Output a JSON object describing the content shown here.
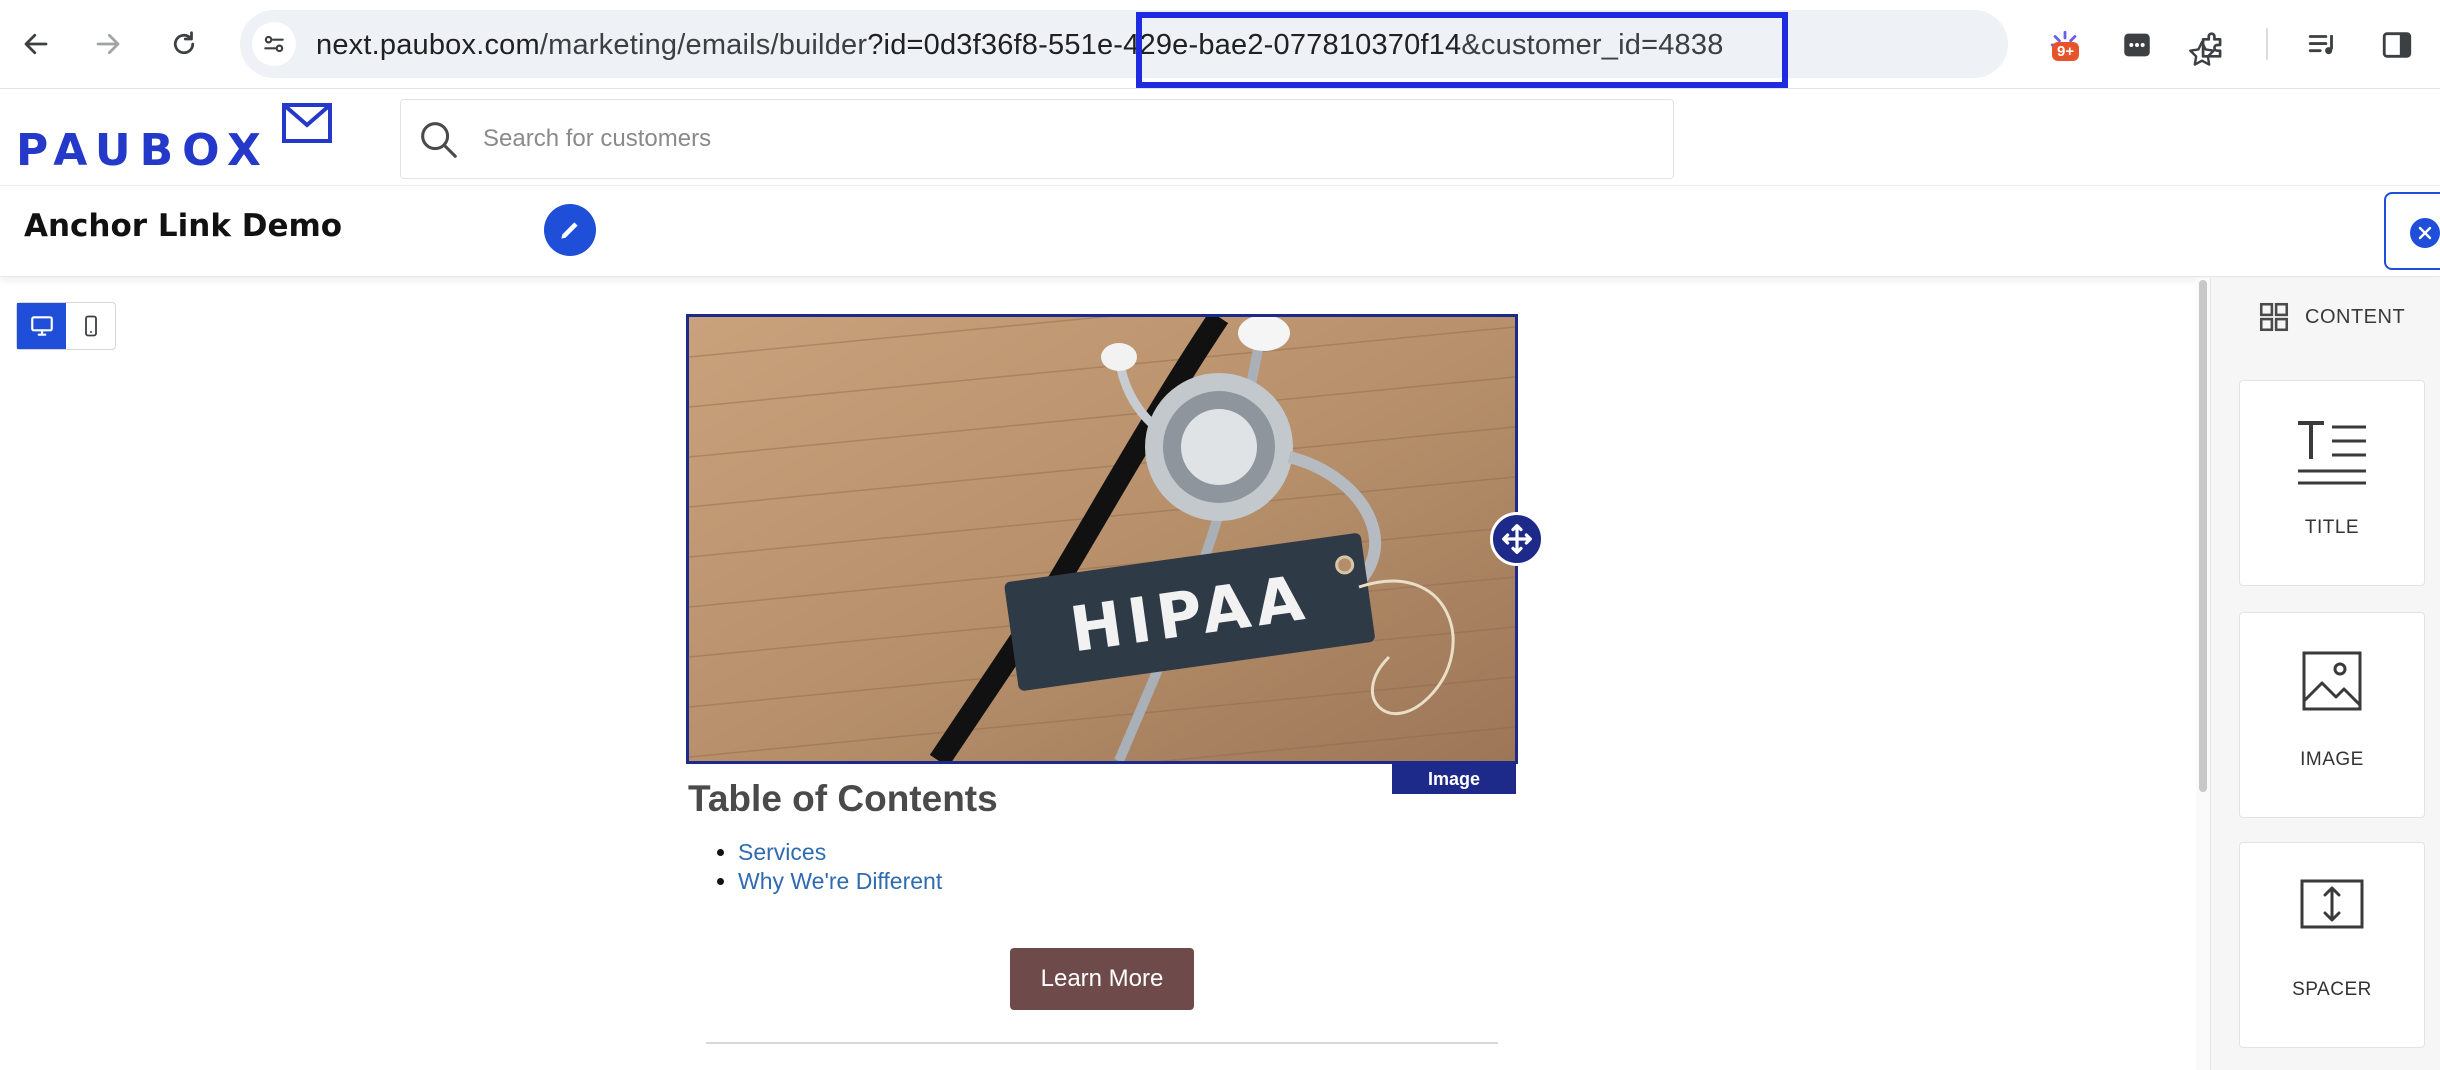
{
  "browser": {
    "url_prefix": "next.paubox.com",
    "url_path": "/marketing/emails/builder",
    "url_highlighted": "?id=0d3f36f8-551e-429e-bae2-077810370f14",
    "url_suffix": "&customer_id=4838",
    "extension_badge": "9+"
  },
  "header": {
    "logo_text": "PAUBOX",
    "search_placeholder": "Search for customers"
  },
  "title_bar": {
    "title": "Anchor Link Demo"
  },
  "canvas": {
    "image_caption_text": "HIPAA",
    "image_tag": "Image",
    "toc_heading": "Table of Contents",
    "toc_items": [
      "Services",
      "Why We're Different"
    ],
    "cta_label": "Learn More"
  },
  "panel": {
    "heading": "CONTENT",
    "tiles": [
      {
        "label": "TITLE",
        "icon": "title-icon"
      },
      {
        "label": "IMAGE",
        "icon": "image-icon"
      },
      {
        "label": "SPACER",
        "icon": "spacer-icon"
      }
    ]
  },
  "colors": {
    "brand_blue": "#2438c9",
    "action_blue": "#1f4fd8",
    "selection_navy": "#1e2a8a",
    "cta_brown": "#6e4a4a",
    "link_blue": "#2e6bb0",
    "url_highlight": "#1f2be0"
  }
}
